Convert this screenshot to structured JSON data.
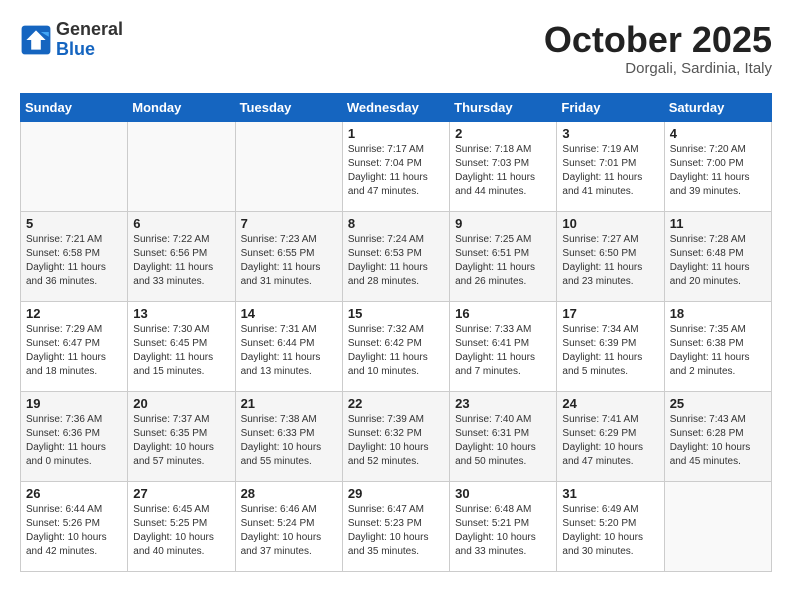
{
  "logo": {
    "general": "General",
    "blue": "Blue"
  },
  "title": "October 2025",
  "location": "Dorgali, Sardinia, Italy",
  "days_of_week": [
    "Sunday",
    "Monday",
    "Tuesday",
    "Wednesday",
    "Thursday",
    "Friday",
    "Saturday"
  ],
  "weeks": [
    [
      {
        "day": "",
        "info": ""
      },
      {
        "day": "",
        "info": ""
      },
      {
        "day": "",
        "info": ""
      },
      {
        "day": "1",
        "info": "Sunrise: 7:17 AM\nSunset: 7:04 PM\nDaylight: 11 hours and 47 minutes."
      },
      {
        "day": "2",
        "info": "Sunrise: 7:18 AM\nSunset: 7:03 PM\nDaylight: 11 hours and 44 minutes."
      },
      {
        "day": "3",
        "info": "Sunrise: 7:19 AM\nSunset: 7:01 PM\nDaylight: 11 hours and 41 minutes."
      },
      {
        "day": "4",
        "info": "Sunrise: 7:20 AM\nSunset: 7:00 PM\nDaylight: 11 hours and 39 minutes."
      }
    ],
    [
      {
        "day": "5",
        "info": "Sunrise: 7:21 AM\nSunset: 6:58 PM\nDaylight: 11 hours and 36 minutes."
      },
      {
        "day": "6",
        "info": "Sunrise: 7:22 AM\nSunset: 6:56 PM\nDaylight: 11 hours and 33 minutes."
      },
      {
        "day": "7",
        "info": "Sunrise: 7:23 AM\nSunset: 6:55 PM\nDaylight: 11 hours and 31 minutes."
      },
      {
        "day": "8",
        "info": "Sunrise: 7:24 AM\nSunset: 6:53 PM\nDaylight: 11 hours and 28 minutes."
      },
      {
        "day": "9",
        "info": "Sunrise: 7:25 AM\nSunset: 6:51 PM\nDaylight: 11 hours and 26 minutes."
      },
      {
        "day": "10",
        "info": "Sunrise: 7:27 AM\nSunset: 6:50 PM\nDaylight: 11 hours and 23 minutes."
      },
      {
        "day": "11",
        "info": "Sunrise: 7:28 AM\nSunset: 6:48 PM\nDaylight: 11 hours and 20 minutes."
      }
    ],
    [
      {
        "day": "12",
        "info": "Sunrise: 7:29 AM\nSunset: 6:47 PM\nDaylight: 11 hours and 18 minutes."
      },
      {
        "day": "13",
        "info": "Sunrise: 7:30 AM\nSunset: 6:45 PM\nDaylight: 11 hours and 15 minutes."
      },
      {
        "day": "14",
        "info": "Sunrise: 7:31 AM\nSunset: 6:44 PM\nDaylight: 11 hours and 13 minutes."
      },
      {
        "day": "15",
        "info": "Sunrise: 7:32 AM\nSunset: 6:42 PM\nDaylight: 11 hours and 10 minutes."
      },
      {
        "day": "16",
        "info": "Sunrise: 7:33 AM\nSunset: 6:41 PM\nDaylight: 11 hours and 7 minutes."
      },
      {
        "day": "17",
        "info": "Sunrise: 7:34 AM\nSunset: 6:39 PM\nDaylight: 11 hours and 5 minutes."
      },
      {
        "day": "18",
        "info": "Sunrise: 7:35 AM\nSunset: 6:38 PM\nDaylight: 11 hours and 2 minutes."
      }
    ],
    [
      {
        "day": "19",
        "info": "Sunrise: 7:36 AM\nSunset: 6:36 PM\nDaylight: 11 hours and 0 minutes."
      },
      {
        "day": "20",
        "info": "Sunrise: 7:37 AM\nSunset: 6:35 PM\nDaylight: 10 hours and 57 minutes."
      },
      {
        "day": "21",
        "info": "Sunrise: 7:38 AM\nSunset: 6:33 PM\nDaylight: 10 hours and 55 minutes."
      },
      {
        "day": "22",
        "info": "Sunrise: 7:39 AM\nSunset: 6:32 PM\nDaylight: 10 hours and 52 minutes."
      },
      {
        "day": "23",
        "info": "Sunrise: 7:40 AM\nSunset: 6:31 PM\nDaylight: 10 hours and 50 minutes."
      },
      {
        "day": "24",
        "info": "Sunrise: 7:41 AM\nSunset: 6:29 PM\nDaylight: 10 hours and 47 minutes."
      },
      {
        "day": "25",
        "info": "Sunrise: 7:43 AM\nSunset: 6:28 PM\nDaylight: 10 hours and 45 minutes."
      }
    ],
    [
      {
        "day": "26",
        "info": "Sunrise: 6:44 AM\nSunset: 5:26 PM\nDaylight: 10 hours and 42 minutes."
      },
      {
        "day": "27",
        "info": "Sunrise: 6:45 AM\nSunset: 5:25 PM\nDaylight: 10 hours and 40 minutes."
      },
      {
        "day": "28",
        "info": "Sunrise: 6:46 AM\nSunset: 5:24 PM\nDaylight: 10 hours and 37 minutes."
      },
      {
        "day": "29",
        "info": "Sunrise: 6:47 AM\nSunset: 5:23 PM\nDaylight: 10 hours and 35 minutes."
      },
      {
        "day": "30",
        "info": "Sunrise: 6:48 AM\nSunset: 5:21 PM\nDaylight: 10 hours and 33 minutes."
      },
      {
        "day": "31",
        "info": "Sunrise: 6:49 AM\nSunset: 5:20 PM\nDaylight: 10 hours and 30 minutes."
      },
      {
        "day": "",
        "info": ""
      }
    ]
  ]
}
